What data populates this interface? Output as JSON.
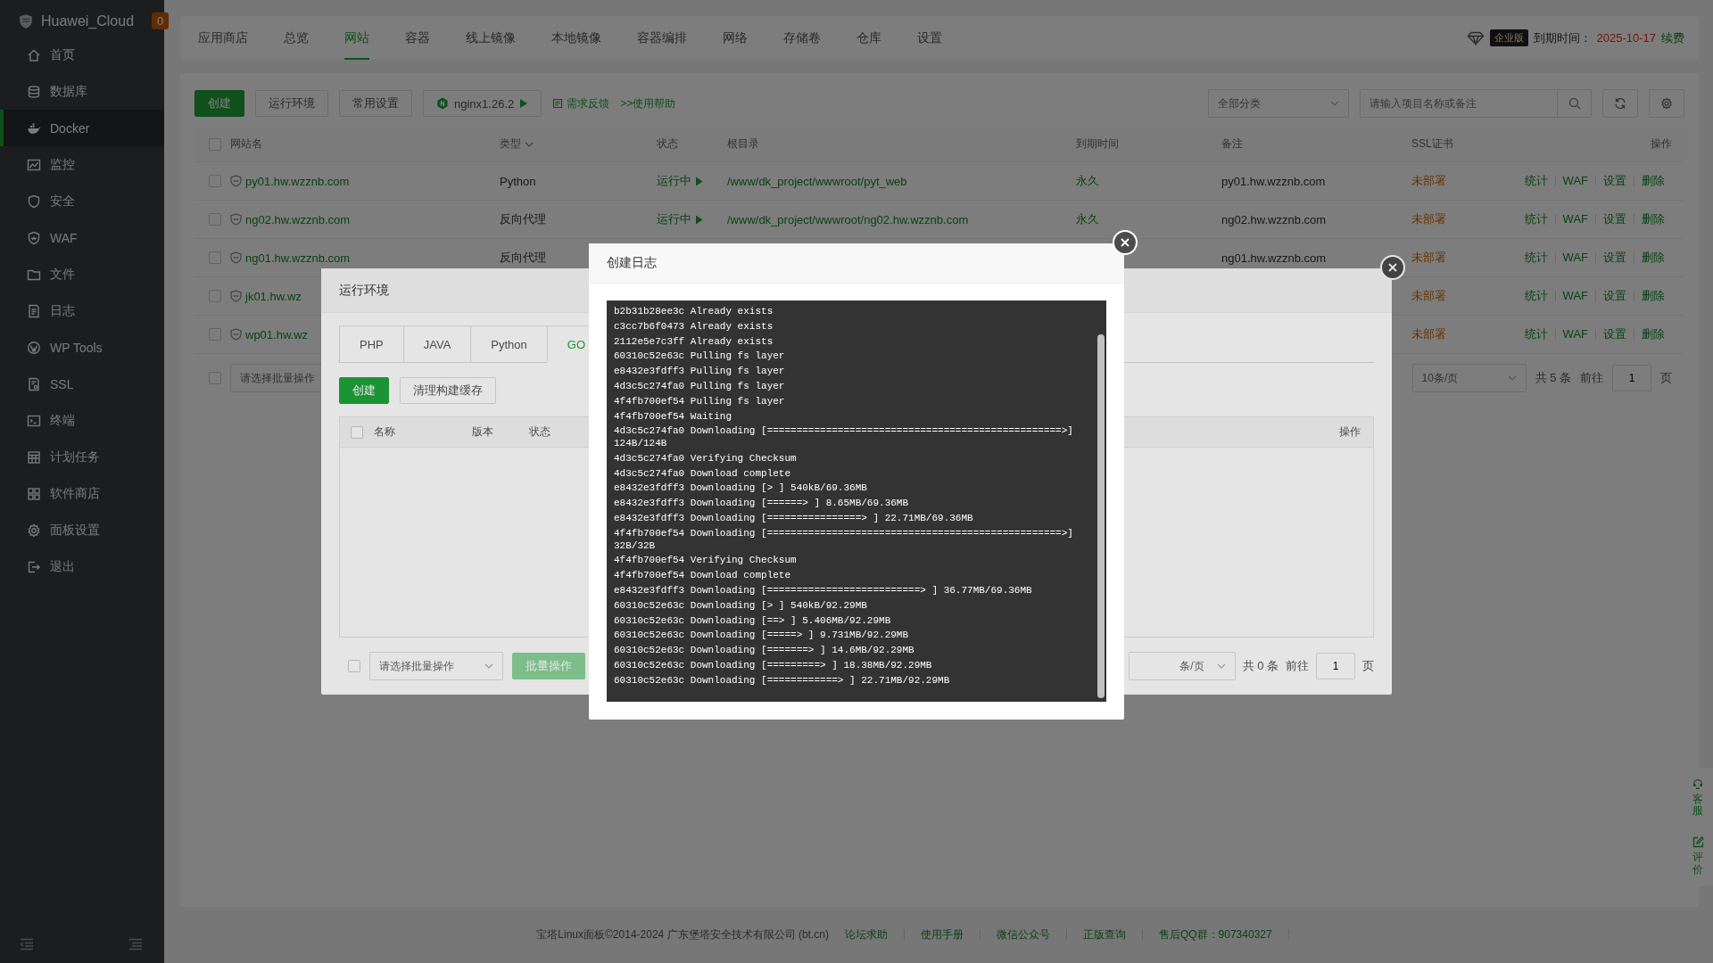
{
  "sidebar": {
    "logo": "Huawei_Cloud",
    "badge": "0",
    "items": [
      {
        "label": "首页",
        "selected": false
      },
      {
        "label": "数据库",
        "selected": false
      },
      {
        "label": "Docker",
        "selected": true
      },
      {
        "label": "监控",
        "selected": false
      },
      {
        "label": "安全",
        "selected": false
      },
      {
        "label": "WAF",
        "selected": false
      },
      {
        "label": "文件",
        "selected": false
      },
      {
        "label": "日志",
        "selected": false
      },
      {
        "label": "WP Tools",
        "selected": false
      },
      {
        "label": "SSL",
        "selected": false
      },
      {
        "label": "终端",
        "selected": false
      },
      {
        "label": "计划任务",
        "selected": false
      },
      {
        "label": "软件商店",
        "selected": false
      },
      {
        "label": "面板设置",
        "selected": false
      },
      {
        "label": "退出",
        "selected": false
      }
    ]
  },
  "top_tabs": [
    {
      "label": "应用商店",
      "selected": false
    },
    {
      "label": "总览",
      "selected": false
    },
    {
      "label": "网站",
      "selected": true
    },
    {
      "label": "容器",
      "selected": false
    },
    {
      "label": "线上镜像",
      "selected": false
    },
    {
      "label": "本地镜像",
      "selected": false
    },
    {
      "label": "容器编排",
      "selected": false
    },
    {
      "label": "网络",
      "selected": false
    },
    {
      "label": "存储卷",
      "selected": false
    },
    {
      "label": "仓库",
      "selected": false
    },
    {
      "label": "设置",
      "selected": false
    }
  ],
  "license": {
    "badge": "企业版",
    "label": "到期时间：",
    "date": "2025-10-17",
    "renew": "续费"
  },
  "toolbar": {
    "buttons": [
      {
        "label": "创建",
        "kind": "primary"
      },
      {
        "label": "运行环境",
        "kind": "default"
      },
      {
        "label": "常用设置",
        "kind": "default"
      }
    ],
    "nginx": "nginx1.26.2",
    "feedback": "需求反馈",
    "help": ">>使用帮助",
    "category": "全部分类",
    "search": {
      "placeholder": "请输入项目名称或备注"
    }
  },
  "table": {
    "select_all": {
      "checked": false
    },
    "columns": [
      "网站名",
      "类型",
      "状态",
      "根目录",
      "到期时间",
      "备注",
      "SSL证书",
      "操作"
    ],
    "rows": [
      {
        "checked": false,
        "name": "py01.hw.wzznb.com",
        "type": "Python",
        "status": "运行中",
        "root": "/www/dk_project/wwwroot/pyt_web",
        "expiry": "永久",
        "remark": "py01.hw.wzznb.com",
        "ssl": "未部署",
        "actions": [
          "统计",
          "WAF",
          "设置",
          "删除"
        ]
      },
      {
        "checked": false,
        "name": "ng02.hw.wzznb.com",
        "type": "反向代理",
        "status": "运行中",
        "root": "/www/dk_project/wwwroot/ng02.hw.wzznb.com",
        "expiry": "永久",
        "remark": "ng02.hw.wzznb.com",
        "ssl": "未部署",
        "actions": [
          "统计",
          "WAF",
          "设置",
          "删除"
        ]
      },
      {
        "checked": false,
        "name": "ng01.hw.wzznb.com",
        "type": "反向代理",
        "remark": "ng01.hw.wzznb.com",
        "ssl": "未部署",
        "actions": [
          "统计",
          "WAF",
          "设置",
          "删除"
        ]
      },
      {
        "checked": false,
        "name": "jk01.hw.wz",
        "ssl": "未部署",
        "actions": [
          "统计",
          "WAF",
          "设置",
          "删除"
        ]
      },
      {
        "checked": false,
        "name": "wp01.hw.wz",
        "ssl": "未部署",
        "actions": [
          "统计",
          "WAF",
          "设置",
          "删除"
        ]
      }
    ]
  },
  "batch": {
    "checked": false,
    "placeholder": "请选择批量操作"
  },
  "pagination": {
    "page_size": "10条/页",
    "total": "共 5 条",
    "goto": "前往",
    "page": "1",
    "unit": "页"
  },
  "float_buttons": [
    {
      "label": "客服"
    },
    {
      "label": "评价"
    }
  ],
  "footer": {
    "text": "宝塔Linux面板©2014-2024 广东堡塔安全技术有限公司 (bt.cn)",
    "links": [
      "论坛求助",
      "使用手册",
      "微信公众号",
      "正版查询",
      "售后QQ群：907340327"
    ]
  },
  "runtime_dialog": {
    "title": "运行环境",
    "tabs": [
      {
        "label": "PHP",
        "selected": false
      },
      {
        "label": "JAVA",
        "selected": false
      },
      {
        "label": "Python",
        "selected": false
      },
      {
        "label": "GO",
        "selected": true
      }
    ],
    "buttons": [
      {
        "label": "创建",
        "kind": "primary"
      },
      {
        "label": "清理构建缓存",
        "kind": "default"
      }
    ],
    "select_all": {
      "checked": false
    },
    "columns": [
      "名称",
      "版本",
      "状态",
      "操作"
    ],
    "batch_checked": false,
    "batch_placeholder": "请选择批量操作",
    "batch_button": "批量操作",
    "pagination": {
      "page_size": "条/页",
      "total": "共 0 条",
      "goto": "前往",
      "page": "1",
      "unit": "页"
    }
  },
  "log_dialog": {
    "title": "创建日志",
    "lines": [
      "b2b31b28ee3c Already exists",
      "c3cc7b6f0473 Already exists",
      "2112e5e7c3ff Already exists",
      "60310c52e63c Pulling fs layer",
      "e8432e3fdff3 Pulling fs layer",
      "4d3c5c274fa0 Pulling fs layer",
      "4f4fb700ef54 Pulling fs layer",
      "4f4fb700ef54 Waiting",
      "4d3c5c274fa0 Downloading [==================================================>] 124B/124B",
      "4d3c5c274fa0 Verifying Checksum",
      "4d3c5c274fa0 Download complete",
      "e8432e3fdff3 Downloading [> ] 540kB/69.36MB",
      "e8432e3fdff3 Downloading [======> ] 8.65MB/69.36MB",
      "e8432e3fdff3 Downloading [================> ] 22.71MB/69.36MB",
      "4f4fb700ef54 Downloading [==================================================>] 32B/32B",
      "4f4fb700ef54 Verifying Checksum",
      "4f4fb700ef54 Download complete",
      "e8432e3fdff3 Downloading [==========================> ] 36.77MB/69.36MB",
      "60310c52e63c Downloading [> ] 540kB/92.29MB",
      "60310c52e63c Downloading [==> ] 5.406MB/92.29MB",
      "60310c52e63c Downloading [=====> ] 9.731MB/92.29MB",
      "60310c52e63c Downloading [=======> ] 14.6MB/92.29MB",
      "60310c52e63c Downloading [=========> ] 18.38MB/92.29MB",
      "60310c52e63c Downloading [============> ] 22.71MB/92.29MB"
    ]
  }
}
